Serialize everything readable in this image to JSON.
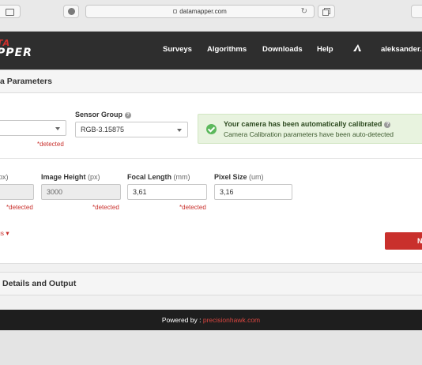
{
  "browser": {
    "url": "datamapper.com",
    "reload_icon": "reload-icon"
  },
  "logo": {
    "line1": "TA",
    "line2": "PPER"
  },
  "nav": {
    "items": [
      {
        "label": "Surveys"
      },
      {
        "label": "Algorithms"
      },
      {
        "label": "Downloads"
      },
      {
        "label": "Help"
      }
    ],
    "user": "aleksander.b"
  },
  "sections": {
    "camera_title": "a Parameters",
    "details_title": "Details and Output"
  },
  "camera": {
    "model": {
      "value": "",
      "detected": "*detected"
    },
    "sensor_group": {
      "label": "Sensor Group",
      "value": "RGB-3.15875"
    },
    "alert": {
      "title": "Your camera has been automatically calibrated",
      "message": "Camera Calibration parameters have been auto-detected"
    }
  },
  "fields": {
    "image_width": {
      "label_unit": "px)",
      "value": "",
      "detected": "*detected"
    },
    "image_height": {
      "label": "Image Height",
      "unit": "(px)",
      "value": "3000",
      "detected": "*detected"
    },
    "focal_length": {
      "label": "Focal Length",
      "unit": "(mm)",
      "value": "3,61",
      "detected": "*detected"
    },
    "pixel_size": {
      "label": "Pixel Size",
      "unit": "(um)",
      "value": "3,16"
    }
  },
  "more_settings": "gs ▾",
  "next_button": "N",
  "footer": {
    "prefix": "Powered by : ",
    "brand": "precisionhawk.com"
  },
  "colors": {
    "accent": "#c9302c",
    "nav_bg": "#2e2e2e",
    "success": "#5cb85c"
  }
}
